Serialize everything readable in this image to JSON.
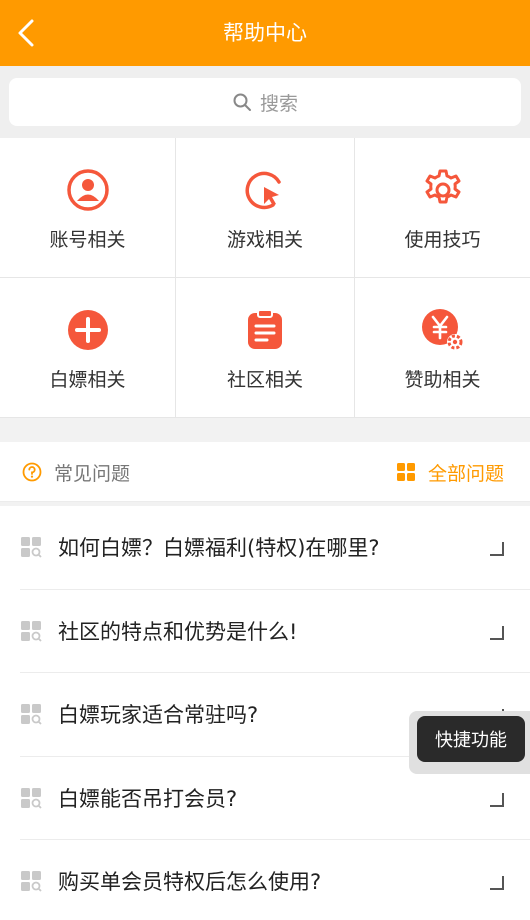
{
  "header": {
    "title": "帮助中心",
    "back_icon": "chevron-left-icon"
  },
  "search": {
    "placeholder": "搜索"
  },
  "categories": [
    {
      "label": "账号相关",
      "icon": "user-circle-icon"
    },
    {
      "label": "游戏相关",
      "icon": "cursor-ring-icon"
    },
    {
      "label": "使用技巧",
      "icon": "gear-icon"
    },
    {
      "label": "白嫖相关",
      "icon": "plus-circle-icon"
    },
    {
      "label": "社区相关",
      "icon": "clipboard-icon"
    },
    {
      "label": "赞助相关",
      "icon": "yen-gear-icon"
    }
  ],
  "faq": {
    "title": "常见问题",
    "all_label": "全部问题"
  },
  "questions": [
    "如何白嫖？白嫖福利(特权)在哪里?",
    "社区的特点和优势是什么!",
    "白嫖玩家适合常驻吗?",
    "白嫖能否吊打会员?",
    "购买单会员特权后怎么使用?"
  ],
  "quick_action": {
    "label": "快捷功能"
  },
  "colors": {
    "accent": "#ff9a00",
    "icon_red": "#f5573b"
  }
}
